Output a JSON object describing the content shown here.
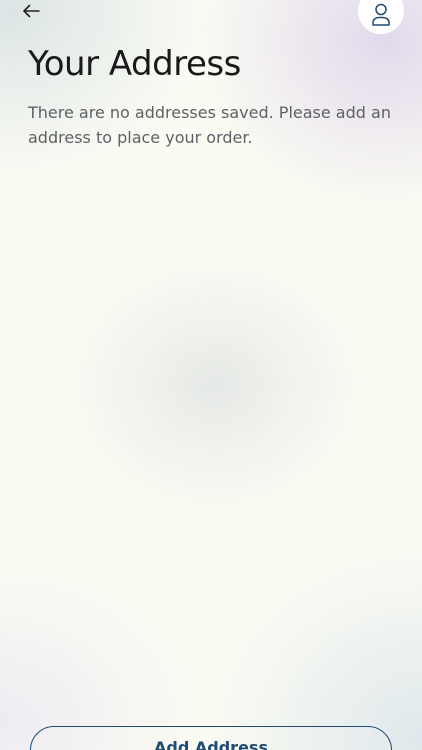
{
  "header": {
    "back_icon": "back-arrow-icon",
    "profile_icon": "user-profile-icon"
  },
  "page": {
    "title": "Your Address",
    "empty_message": "There are no addresses saved. Please add an address to place your order."
  },
  "footer": {
    "add_address_label": "Add Address"
  },
  "colors": {
    "accent": "#1f4b73",
    "title": "#1a1a1a",
    "body_text": "#5e6166",
    "background": "#fbfbf3"
  }
}
